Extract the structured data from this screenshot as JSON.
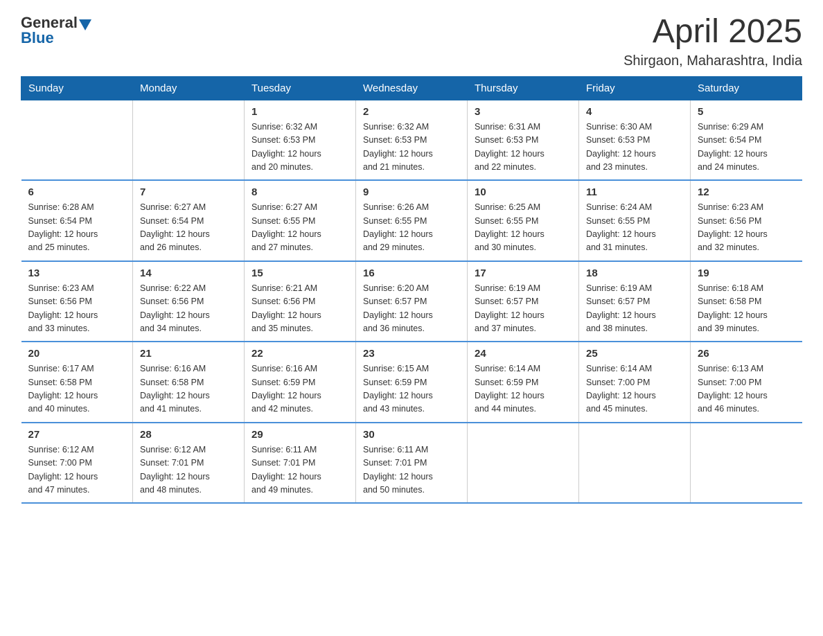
{
  "header": {
    "logo": {
      "text_general": "General",
      "text_blue": "Blue"
    },
    "title": "April 2025",
    "subtitle": "Shirgaon, Maharashtra, India"
  },
  "weekdays": [
    "Sunday",
    "Monday",
    "Tuesday",
    "Wednesday",
    "Thursday",
    "Friday",
    "Saturday"
  ],
  "weeks": [
    [
      {
        "day": "",
        "info": ""
      },
      {
        "day": "",
        "info": ""
      },
      {
        "day": "1",
        "info": "Sunrise: 6:32 AM\nSunset: 6:53 PM\nDaylight: 12 hours\nand 20 minutes."
      },
      {
        "day": "2",
        "info": "Sunrise: 6:32 AM\nSunset: 6:53 PM\nDaylight: 12 hours\nand 21 minutes."
      },
      {
        "day": "3",
        "info": "Sunrise: 6:31 AM\nSunset: 6:53 PM\nDaylight: 12 hours\nand 22 minutes."
      },
      {
        "day": "4",
        "info": "Sunrise: 6:30 AM\nSunset: 6:53 PM\nDaylight: 12 hours\nand 23 minutes."
      },
      {
        "day": "5",
        "info": "Sunrise: 6:29 AM\nSunset: 6:54 PM\nDaylight: 12 hours\nand 24 minutes."
      }
    ],
    [
      {
        "day": "6",
        "info": "Sunrise: 6:28 AM\nSunset: 6:54 PM\nDaylight: 12 hours\nand 25 minutes."
      },
      {
        "day": "7",
        "info": "Sunrise: 6:27 AM\nSunset: 6:54 PM\nDaylight: 12 hours\nand 26 minutes."
      },
      {
        "day": "8",
        "info": "Sunrise: 6:27 AM\nSunset: 6:55 PM\nDaylight: 12 hours\nand 27 minutes."
      },
      {
        "day": "9",
        "info": "Sunrise: 6:26 AM\nSunset: 6:55 PM\nDaylight: 12 hours\nand 29 minutes."
      },
      {
        "day": "10",
        "info": "Sunrise: 6:25 AM\nSunset: 6:55 PM\nDaylight: 12 hours\nand 30 minutes."
      },
      {
        "day": "11",
        "info": "Sunrise: 6:24 AM\nSunset: 6:55 PM\nDaylight: 12 hours\nand 31 minutes."
      },
      {
        "day": "12",
        "info": "Sunrise: 6:23 AM\nSunset: 6:56 PM\nDaylight: 12 hours\nand 32 minutes."
      }
    ],
    [
      {
        "day": "13",
        "info": "Sunrise: 6:23 AM\nSunset: 6:56 PM\nDaylight: 12 hours\nand 33 minutes."
      },
      {
        "day": "14",
        "info": "Sunrise: 6:22 AM\nSunset: 6:56 PM\nDaylight: 12 hours\nand 34 minutes."
      },
      {
        "day": "15",
        "info": "Sunrise: 6:21 AM\nSunset: 6:56 PM\nDaylight: 12 hours\nand 35 minutes."
      },
      {
        "day": "16",
        "info": "Sunrise: 6:20 AM\nSunset: 6:57 PM\nDaylight: 12 hours\nand 36 minutes."
      },
      {
        "day": "17",
        "info": "Sunrise: 6:19 AM\nSunset: 6:57 PM\nDaylight: 12 hours\nand 37 minutes."
      },
      {
        "day": "18",
        "info": "Sunrise: 6:19 AM\nSunset: 6:57 PM\nDaylight: 12 hours\nand 38 minutes."
      },
      {
        "day": "19",
        "info": "Sunrise: 6:18 AM\nSunset: 6:58 PM\nDaylight: 12 hours\nand 39 minutes."
      }
    ],
    [
      {
        "day": "20",
        "info": "Sunrise: 6:17 AM\nSunset: 6:58 PM\nDaylight: 12 hours\nand 40 minutes."
      },
      {
        "day": "21",
        "info": "Sunrise: 6:16 AM\nSunset: 6:58 PM\nDaylight: 12 hours\nand 41 minutes."
      },
      {
        "day": "22",
        "info": "Sunrise: 6:16 AM\nSunset: 6:59 PM\nDaylight: 12 hours\nand 42 minutes."
      },
      {
        "day": "23",
        "info": "Sunrise: 6:15 AM\nSunset: 6:59 PM\nDaylight: 12 hours\nand 43 minutes."
      },
      {
        "day": "24",
        "info": "Sunrise: 6:14 AM\nSunset: 6:59 PM\nDaylight: 12 hours\nand 44 minutes."
      },
      {
        "day": "25",
        "info": "Sunrise: 6:14 AM\nSunset: 7:00 PM\nDaylight: 12 hours\nand 45 minutes."
      },
      {
        "day": "26",
        "info": "Sunrise: 6:13 AM\nSunset: 7:00 PM\nDaylight: 12 hours\nand 46 minutes."
      }
    ],
    [
      {
        "day": "27",
        "info": "Sunrise: 6:12 AM\nSunset: 7:00 PM\nDaylight: 12 hours\nand 47 minutes."
      },
      {
        "day": "28",
        "info": "Sunrise: 6:12 AM\nSunset: 7:01 PM\nDaylight: 12 hours\nand 48 minutes."
      },
      {
        "day": "29",
        "info": "Sunrise: 6:11 AM\nSunset: 7:01 PM\nDaylight: 12 hours\nand 49 minutes."
      },
      {
        "day": "30",
        "info": "Sunrise: 6:11 AM\nSunset: 7:01 PM\nDaylight: 12 hours\nand 50 minutes."
      },
      {
        "day": "",
        "info": ""
      },
      {
        "day": "",
        "info": ""
      },
      {
        "day": "",
        "info": ""
      }
    ]
  ]
}
